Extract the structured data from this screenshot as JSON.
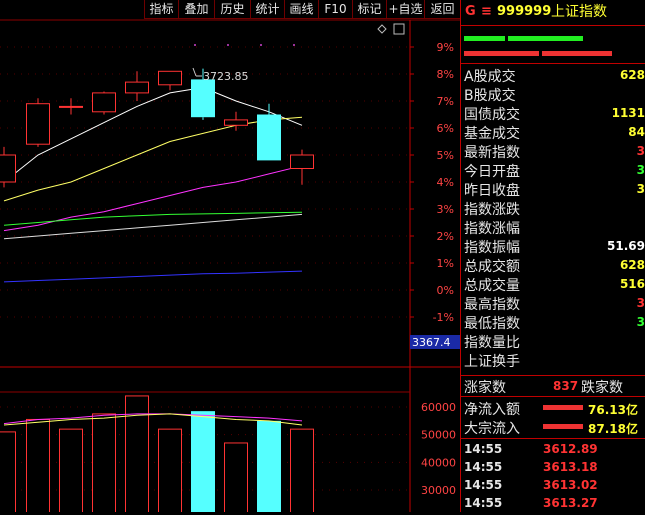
{
  "toolbar": {
    "buttons": [
      "指标",
      "叠加",
      "历史",
      "统计",
      "画线",
      "F10",
      "标记",
      "+自选",
      "返回"
    ]
  },
  "chart_data": {
    "type": "candlestick",
    "pct_axis": [
      "9%",
      "8%",
      "7%",
      "6%",
      "5%",
      "4%",
      "3%",
      "2%",
      "1%",
      "0%",
      "-1%"
    ],
    "price_marker": "3367.4",
    "high_annotation": "3723.85",
    "volume_axis": [
      "60000",
      "50000",
      "40000",
      "30000"
    ],
    "candles": [
      {
        "o": 4.0,
        "c": 5.0,
        "h": 5.3,
        "l": 3.8,
        "dir": "up"
      },
      {
        "o": 5.4,
        "c": 6.9,
        "h": 7.1,
        "l": 5.3,
        "dir": "up"
      },
      {
        "o": 6.8,
        "c": 6.8,
        "h": 7.1,
        "l": 6.5,
        "dir": "up"
      },
      {
        "o": 6.6,
        "c": 7.3,
        "h": 7.35,
        "l": 6.5,
        "dir": "up"
      },
      {
        "o": 7.3,
        "c": 7.7,
        "h": 8.1,
        "l": 7.0,
        "dir": "up"
      },
      {
        "o": 7.6,
        "c": 8.1,
        "h": 8.1,
        "l": 7.4,
        "dir": "up"
      },
      {
        "o": 7.8,
        "c": 6.4,
        "h": 8.2,
        "l": 6.3,
        "dir": "down"
      },
      {
        "o": 6.1,
        "c": 6.3,
        "h": 6.6,
        "l": 5.9,
        "dir": "up"
      },
      {
        "o": 6.5,
        "c": 4.8,
        "h": 6.9,
        "l": 4.8,
        "dir": "down"
      },
      {
        "o": 4.5,
        "c": 5.0,
        "h": 5.2,
        "l": 3.9,
        "dir": "up"
      }
    ],
    "volumes": [
      51000,
      55500,
      52000,
      57500,
      64000,
      52000,
      58500,
      47000,
      55000,
      52000
    ],
    "ma_lines": [
      {
        "color": "#ffffff",
        "pts": [
          4.0,
          5.0,
          5.6,
          6.2,
          6.8,
          7.3,
          7.5,
          7.0,
          6.6,
          6.1
        ]
      },
      {
        "color": "#ffff66",
        "pts": [
          3.3,
          3.7,
          4.0,
          4.5,
          5.0,
          5.5,
          5.8,
          6.1,
          6.3,
          6.4
        ]
      },
      {
        "color": "#ff33ff",
        "pts": [
          2.2,
          2.4,
          2.7,
          2.9,
          3.2,
          3.5,
          3.8,
          4.0,
          4.3,
          4.6
        ]
      },
      {
        "color": "#33ff33",
        "pts": [
          2.4,
          2.5,
          2.6,
          2.7,
          2.75,
          2.8,
          2.82,
          2.84,
          2.86,
          2.88
        ]
      },
      {
        "color": "#dddddd",
        "pts": [
          1.9,
          2.0,
          2.1,
          2.2,
          2.3,
          2.4,
          2.5,
          2.6,
          2.7,
          2.8
        ]
      },
      {
        "color": "#3333ff",
        "pts": [
          0.3,
          0.35,
          0.4,
          0.45,
          0.5,
          0.55,
          0.6,
          0.62,
          0.66,
          0.7
        ]
      }
    ],
    "vol_ma": [
      {
        "color": "#ff33ff",
        "pts": [
          54000,
          55500,
          56000,
          57000,
          57500,
          57500,
          57000,
          56500,
          56000,
          55000
        ]
      },
      {
        "color": "#ffff66",
        "pts": [
          53500,
          54500,
          55500,
          56000,
          57000,
          57500,
          56500,
          55500,
          55000,
          53500
        ]
      }
    ]
  },
  "right_panel": {
    "header": {
      "badge": "G",
      "menu_icon": "≡",
      "code": "999999",
      "name": "上证指数"
    },
    "stats": [
      {
        "label": "A股成交",
        "value": "628",
        "color": "#ffff33"
      },
      {
        "label": "B股成交",
        "value": "",
        "color": "#ffff33"
      },
      {
        "label": "国债成交",
        "value": "1131",
        "color": "#ffff33"
      },
      {
        "label": "基金成交",
        "value": "84",
        "color": "#ffff33"
      },
      {
        "label": "最新指数",
        "value": "3",
        "color": "#ff3333"
      },
      {
        "label": "今日开盘",
        "value": "3",
        "color": "#33ff33"
      },
      {
        "label": "昨日收盘",
        "value": "3",
        "color": "#ffff33"
      },
      {
        "label": "指数涨跌",
        "value": "",
        "color": "#ffff33"
      },
      {
        "label": "指数涨幅",
        "value": "",
        "color": "#ffff33"
      },
      {
        "label": "指数振幅",
        "value": "51.69",
        "color": "#ffffff"
      },
      {
        "label": "总成交额",
        "value": "628",
        "color": "#ffff33"
      },
      {
        "label": "总成交量",
        "value": "516",
        "color": "#ffff33"
      },
      {
        "label": "最高指数",
        "value": "3",
        "color": "#ff3333"
      },
      {
        "label": "最低指数",
        "value": "3",
        "color": "#33ff33"
      },
      {
        "label": "指数量比",
        "value": "",
        "color": "#ffff33"
      },
      {
        "label": "上证换手",
        "value": "",
        "color": "#ffff33"
      }
    ],
    "breadth": {
      "label1": "涨家数",
      "value": "837",
      "label2": "跌家数"
    },
    "flows": [
      {
        "label": "净流入额",
        "value": "76.13亿"
      },
      {
        "label": "大宗流入",
        "value": "87.18亿"
      }
    ],
    "ticks": [
      {
        "time": "14:55",
        "price": "3612.89"
      },
      {
        "time": "14:55",
        "price": "3613.18"
      },
      {
        "time": "14:55",
        "price": "3613.02"
      },
      {
        "time": "14:55",
        "price": "3613.27"
      }
    ]
  }
}
